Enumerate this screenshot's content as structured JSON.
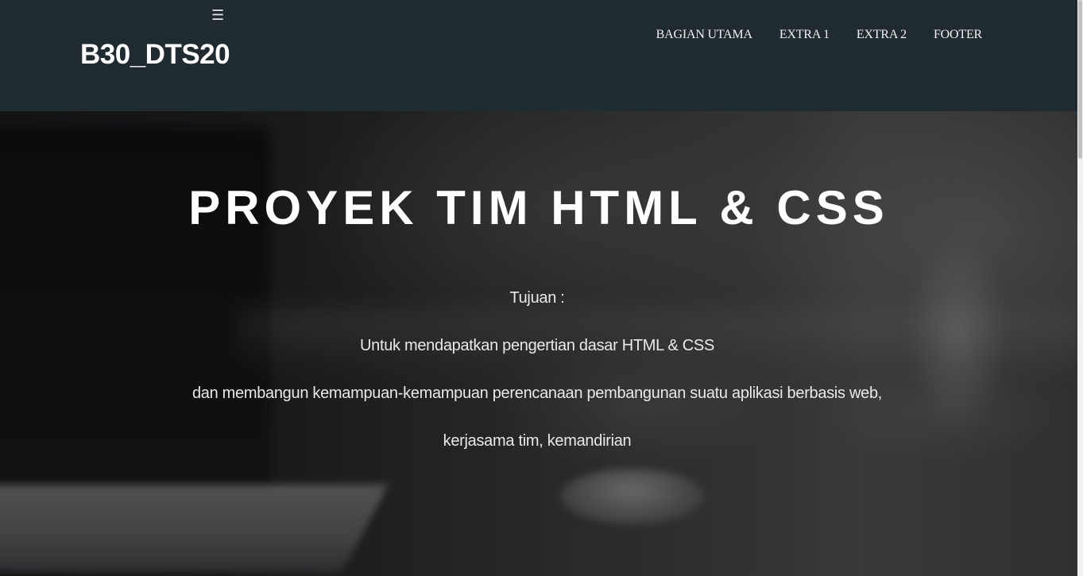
{
  "header": {
    "brand": "B30_DTS20",
    "menu_icon": "hamburger-icon",
    "menu_glyph": "☰",
    "nav": [
      {
        "label": "BAGIAN UTAMA"
      },
      {
        "label": "EXTRA 1"
      },
      {
        "label": "EXTRA 2"
      },
      {
        "label": "FOOTER"
      }
    ]
  },
  "hero": {
    "title": "PROYEK TIM HTML & CSS",
    "lines": [
      "Tujuan :",
      "Untuk mendapatkan pengertian dasar HTML & CSS",
      "dan membangun kemampuan-kemampuan perencanaan pembangunan suatu aplikasi berbasis web,",
      "kerjasama tim, kemandirian"
    ]
  },
  "colors": {
    "header_bg": "#1f2b30",
    "text": "#ffffff"
  }
}
